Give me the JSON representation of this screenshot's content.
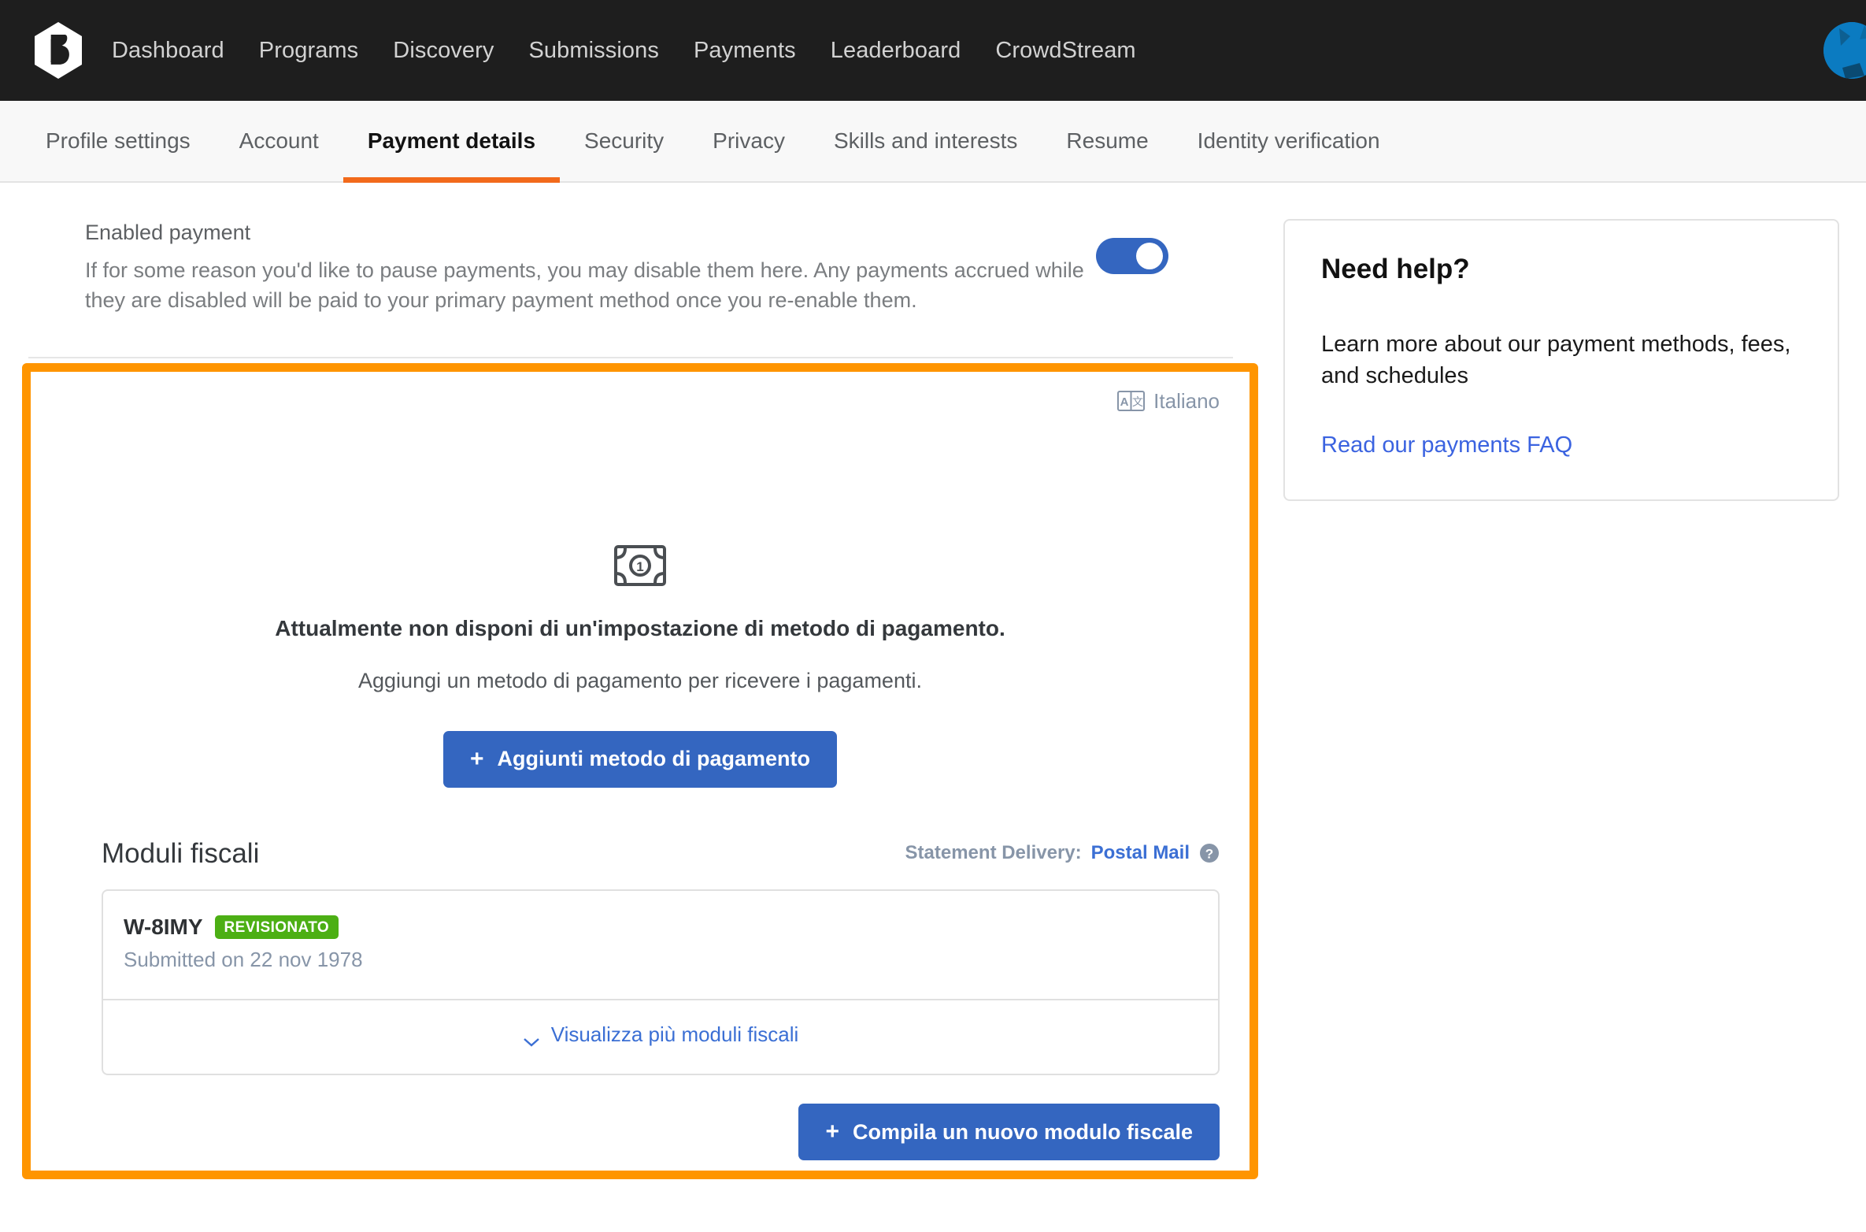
{
  "nav": {
    "logo_icon": "bugcrowd-logo-icon",
    "links": [
      {
        "label": "Dashboard"
      },
      {
        "label": "Programs"
      },
      {
        "label": "Discovery"
      },
      {
        "label": "Submissions"
      },
      {
        "label": "Payments"
      },
      {
        "label": "Leaderboard"
      },
      {
        "label": "CrowdStream"
      }
    ],
    "avatar_icon": "user-avatar"
  },
  "tabs": [
    {
      "label": "Profile settings",
      "active": false
    },
    {
      "label": "Account",
      "active": false
    },
    {
      "label": "Payment details",
      "active": true
    },
    {
      "label": "Security",
      "active": false
    },
    {
      "label": "Privacy",
      "active": false
    },
    {
      "label": "Skills and interests",
      "active": false
    },
    {
      "label": "Resume",
      "active": false
    },
    {
      "label": "Identity verification",
      "active": false
    }
  ],
  "enabled_payment": {
    "title": "Enabled payment",
    "description": "If for some reason you'd like to pause payments, you may disable them here. Any payments accrued while they are disabled will be paid to your primary payment method once you re-enable them.",
    "toggle_state": "on"
  },
  "language_indicator": {
    "icon": "translate-icon",
    "label": "Italiano"
  },
  "empty_state": {
    "icon": "banknote-icon",
    "title": "Attualmente non disponi di un'impostazione di metodo di pagamento.",
    "subtitle": "Aggiungi un metodo di pagamento per ricevere i pagamenti.",
    "button_plus": "+",
    "button_label": "Aggiunti metodo di pagamento"
  },
  "tax_forms": {
    "title": "Moduli fiscali",
    "statement_delivery_label": "Statement Delivery:",
    "statement_delivery_value": "Postal Mail",
    "help_icon": "question-mark-circle-icon",
    "rows": [
      {
        "name": "W-8IMY",
        "badge": "REVISIONATO",
        "submitted": "Submitted on 22 nov 1978"
      }
    ],
    "expand_label": "Visualizza più moduli fiscali",
    "expand_icon": "chevron-down-icon",
    "new_form_plus": "+",
    "new_form_label": "Compila un nuovo modulo fiscale"
  },
  "help_card": {
    "title": "Need help?",
    "body": "Learn more about our payment methods, fees, and schedules",
    "link": "Read our payments FAQ"
  },
  "colors": {
    "navbar_bg": "#1e1e1e",
    "accent_orange": "#f26a1b",
    "highlight_orange": "#ff9500",
    "primary_blue": "#3466c0",
    "link_blue": "#3b6fd4",
    "badge_green": "#4caf14",
    "muted_blue_gray": "#8795a8"
  }
}
